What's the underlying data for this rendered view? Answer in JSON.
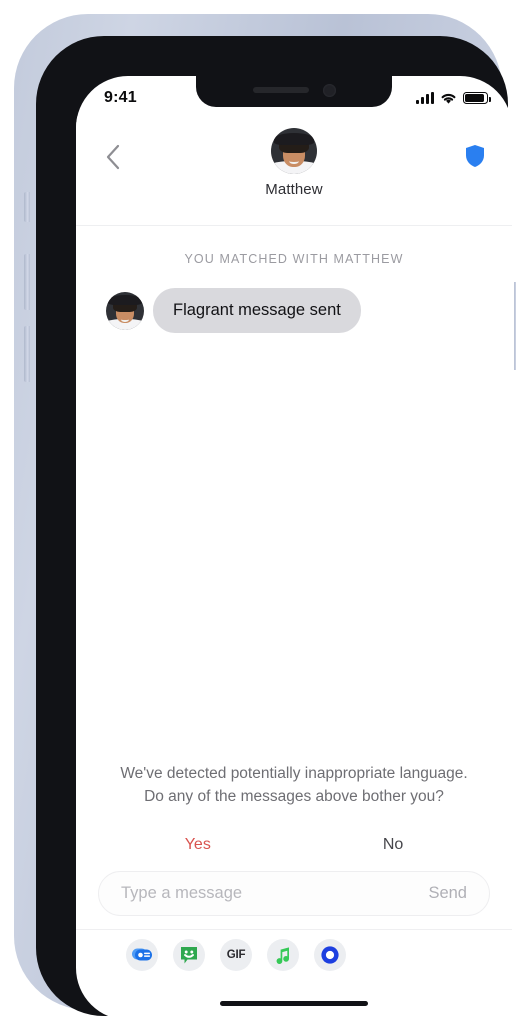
{
  "device": {
    "status_bar": {
      "time": "9:41",
      "signal_icon": "cellular-signal-icon",
      "wifi_icon": "wifi-icon",
      "battery_icon": "battery-full-icon"
    },
    "home_indicator": "home-indicator"
  },
  "nav": {
    "back_icon": "back-chevron-icon",
    "contact_name": "Matthew",
    "avatar": "contact-avatar",
    "safety_icon": "shield-icon"
  },
  "conversation": {
    "match_banner": "YOU MATCHED WITH MATTHEW",
    "messages": [
      {
        "sender": "Matthew",
        "text": "Flagrant message sent",
        "side": "incoming"
      }
    ]
  },
  "safety_prompt": {
    "line1": "We've detected potentially inappropriate language.",
    "line2": "Do any of the messages above bother you?",
    "yes_label": "Yes",
    "no_label": "No",
    "yes_color": "#d9534f",
    "no_color": "#46464b"
  },
  "composer": {
    "placeholder": "Type a message",
    "send_label": "Send"
  },
  "tray": {
    "icons": [
      {
        "name": "imessage-apps-icon",
        "color": "#2a7ff0"
      },
      {
        "name": "sticker-smiley-icon",
        "color": "#34a853"
      },
      {
        "name": "gif-icon",
        "label": "GIF",
        "color": "#2b2b30"
      },
      {
        "name": "music-note-icon",
        "color": "#34c759"
      },
      {
        "name": "ring-circle-icon",
        "color": "#2342e8"
      }
    ]
  },
  "colors": {
    "bubble_incoming": "#d9d9dd",
    "banner_text": "#9b9ba1",
    "accent_blue": "#2a7ff0"
  }
}
